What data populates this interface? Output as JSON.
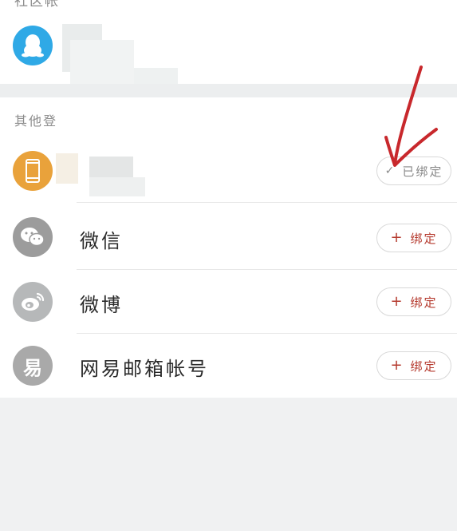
{
  "top_section": {
    "partial_header": "社区帐"
  },
  "other_section": {
    "header": "其他登"
  },
  "accounts": {
    "qq": {
      "icon": "qq-penguin-icon",
      "color": "#2fa9e6"
    },
    "phone": {
      "icon": "mobile-phone-icon",
      "color": "#e9a23b",
      "status_check": "✓",
      "status_label": "已绑定"
    },
    "wechat": {
      "icon": "wechat-icon",
      "color": "#9c9c9c",
      "label": "微信",
      "action_plus": "+",
      "action_label": "绑定"
    },
    "weibo": {
      "icon": "weibo-icon",
      "color": "#b6b8b9",
      "label": "微博",
      "action_plus": "+",
      "action_label": "绑定"
    },
    "netease": {
      "icon": "netease-yi-icon",
      "color": "#a9a9a9",
      "glyph": "易",
      "label": "网易邮箱帐号",
      "action_plus": "+",
      "action_label": "绑定"
    }
  },
  "colors": {
    "accent_red": "#b53a2e",
    "annotation_red": "#c8282c"
  }
}
